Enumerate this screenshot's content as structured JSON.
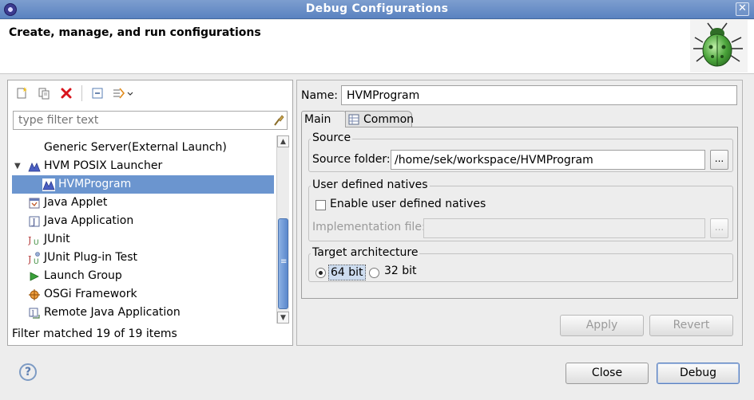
{
  "window": {
    "title": "Debug Configurations",
    "close_glyph": "✕"
  },
  "header": {
    "heading": "Create, manage, and run configurations",
    "icon": "bug-icon"
  },
  "left_panel": {
    "toolbar": [
      {
        "icon": "new-config-icon"
      },
      {
        "icon": "duplicate-icon"
      },
      {
        "icon": "delete-icon"
      },
      {
        "icon": "collapse-all-icon"
      },
      {
        "icon": "filter-dropdown-icon"
      }
    ],
    "filter_placeholder": "type filter text",
    "tree": [
      {
        "label": "Generic Server(External Launch)",
        "level": 1
      },
      {
        "label": "HVM POSIX Launcher",
        "level": 0,
        "expanded": true
      },
      {
        "label": "HVMProgram",
        "level": 2,
        "selected": true
      },
      {
        "label": "Java Applet",
        "level": 1
      },
      {
        "label": "Java Application",
        "level": 1
      },
      {
        "label": "JUnit",
        "level": 1
      },
      {
        "label": "JUnit Plug-in Test",
        "level": 1
      },
      {
        "label": "Launch Group",
        "level": 1
      },
      {
        "label": "OSGi Framework",
        "level": 1
      },
      {
        "label": "Remote Java Application",
        "level": 1
      }
    ],
    "filter_status": "Filter matched 19 of 19 items"
  },
  "right_panel": {
    "name_label": "Name:",
    "name_value": "HVMProgram",
    "tabs": [
      {
        "label": "Main",
        "active": true
      },
      {
        "label": "Common",
        "active": false
      }
    ],
    "source": {
      "group_title": "Source",
      "folder_label": "Source folder:",
      "folder_value": "/home/sek/workspace/HVMProgram",
      "browse_label": "..."
    },
    "natives": {
      "group_title": "User defined natives",
      "checkbox_label": "Enable user defined natives",
      "checked": false,
      "impl_label": "Implementation file:",
      "impl_value": "",
      "browse_label": "..."
    },
    "arch": {
      "group_title": "Target architecture",
      "options": [
        {
          "label": "64 bit",
          "selected": true
        },
        {
          "label": "32 bit",
          "selected": false
        }
      ]
    },
    "apply_label": "Apply",
    "revert_label": "Revert"
  },
  "footer": {
    "help_glyph": "?",
    "close_label": "Close",
    "debug_label": "Debug"
  }
}
